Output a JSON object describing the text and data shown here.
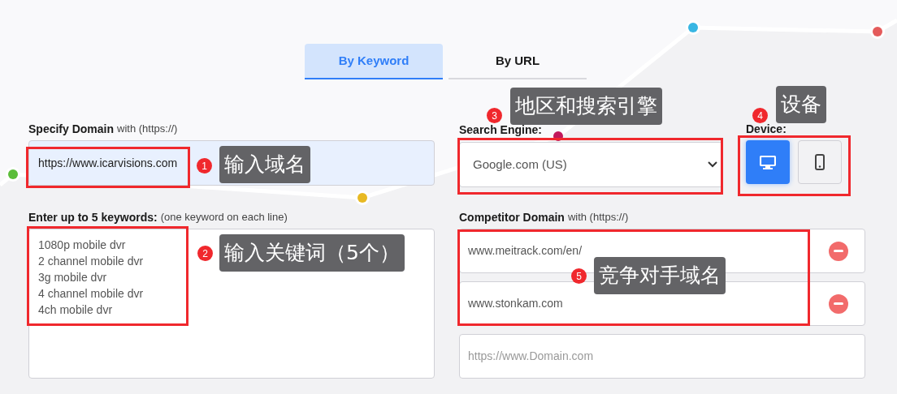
{
  "tabs": [
    {
      "label": "By Keyword",
      "selected": true
    },
    {
      "label": "By URL",
      "selected": false
    }
  ],
  "domain": {
    "label": "Specify Domain",
    "hint": "with (https://)",
    "value": "https://www.icarvisions.com"
  },
  "search_engine": {
    "label": "Search Engine:",
    "value": "Google.com (US)"
  },
  "device": {
    "label": "Device:",
    "options": [
      {
        "kind": "desktop",
        "selected": true
      },
      {
        "kind": "mobile",
        "selected": false
      }
    ]
  },
  "keywords": {
    "label": "Enter up to 5 keywords:",
    "hint": "(one keyword on each line)",
    "lines": [
      "1080p mobile dvr",
      "2 channel mobile dvr",
      "3g mobile dvr",
      "4 channel mobile dvr",
      "4ch mobile dvr"
    ]
  },
  "competitors": {
    "label": "Competitor Domain",
    "hint": "with (https://)",
    "fields": [
      {
        "value": "www.meitrack.com/en/",
        "removable": true
      },
      {
        "value": "www.stonkam.com",
        "removable": true
      },
      {
        "placeholder": "https://www.Domain.com",
        "removable": false
      }
    ]
  },
  "annotations": [
    {
      "number": "1",
      "text": "输入域名"
    },
    {
      "number": "2",
      "text": "输入关键词（5个）"
    },
    {
      "number": "3",
      "text": "地区和搜索引擎"
    },
    {
      "number": "4",
      "text": "设备"
    },
    {
      "number": "5",
      "text": "竞争对手域名"
    }
  ]
}
